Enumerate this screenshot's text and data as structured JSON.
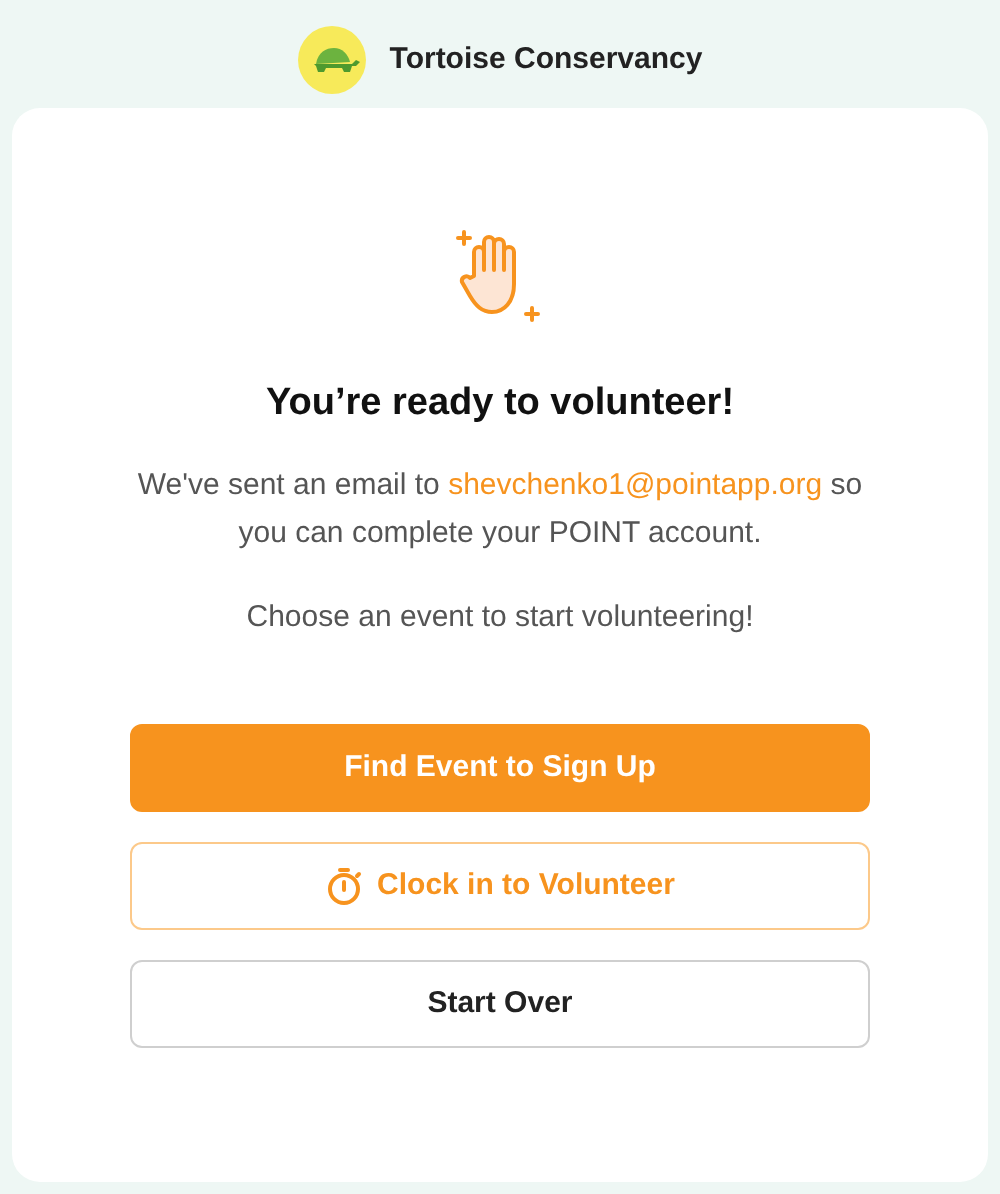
{
  "header": {
    "organization": "Tortoise Conservancy"
  },
  "title": "You’re ready to volunteer!",
  "message": {
    "before": "We've sent an email to",
    "email": "shevchenko1@pointapp.org",
    "after": "so you can complete your POINT account."
  },
  "prompt": "Choose an event to start volunteering!",
  "buttons": [
    {
      "label": "Find Event to Sign Up",
      "kind": "primary"
    },
    {
      "label": "Clock in to Volunteer",
      "kind": "outline"
    },
    {
      "label": "Start Over",
      "kind": "secondary"
    }
  ]
}
